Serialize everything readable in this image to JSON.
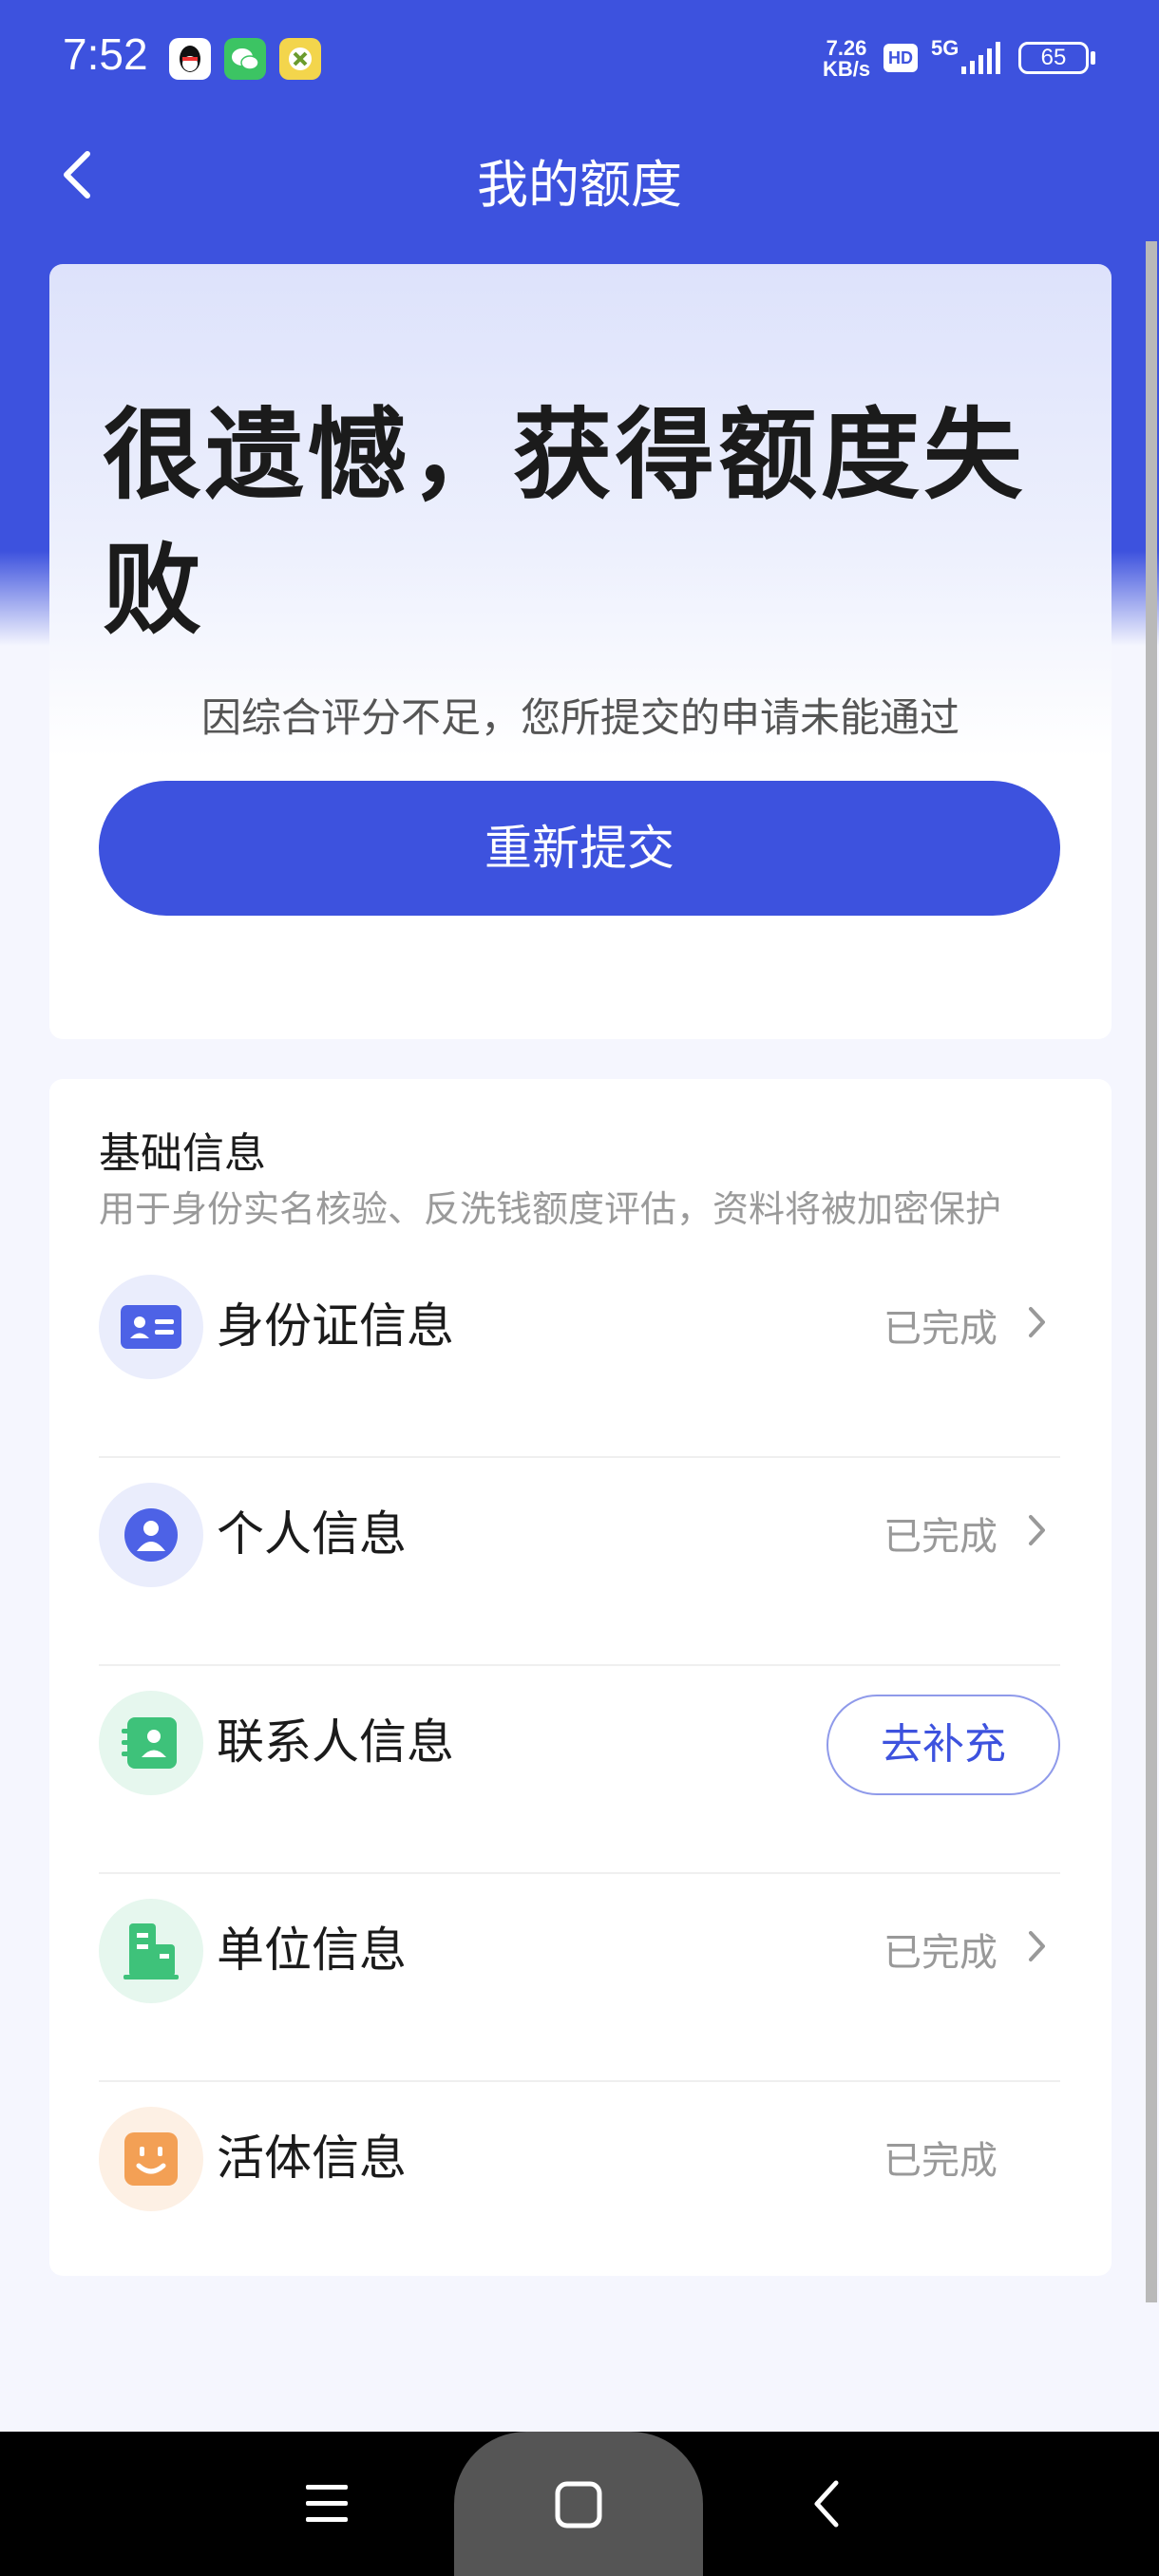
{
  "status_bar": {
    "time": "7:52",
    "net_speed_value": "7.26",
    "net_speed_unit": "KB/s",
    "hd": "HD",
    "network": "5G",
    "battery": "65",
    "icons": [
      "qq-icon",
      "wechat-icon",
      "game-icon",
      "signal-icon",
      "battery-icon"
    ]
  },
  "header": {
    "title": "我的额度"
  },
  "result": {
    "title": "很遗憾，获得额度失败",
    "description": "因综合评分不足，您所提交的申请未能通过",
    "button_label": "重新提交"
  },
  "basic_info": {
    "title": "基础信息",
    "subtitle": "用于身份实名核验、反洗钱额度评估，资料将被加密保护",
    "items": [
      {
        "label": "身份证信息",
        "status": "已完成",
        "icon": "id-card-icon",
        "color": "#4d62e6"
      },
      {
        "label": "个人信息",
        "status": "已完成",
        "icon": "person-icon",
        "color": "#4d62e6"
      },
      {
        "label": "联系人信息",
        "action": "去补充",
        "icon": "contact-icon",
        "color": "#3ec27a"
      },
      {
        "label": "单位信息",
        "status": "已完成",
        "icon": "building-icon",
        "color": "#3ec27a"
      },
      {
        "label": "活体信息",
        "status": "已完成",
        "icon": "face-icon",
        "color": "#f3a055"
      }
    ]
  },
  "colors": {
    "primary": "#3d52de",
    "background": "#f5f6fe"
  }
}
